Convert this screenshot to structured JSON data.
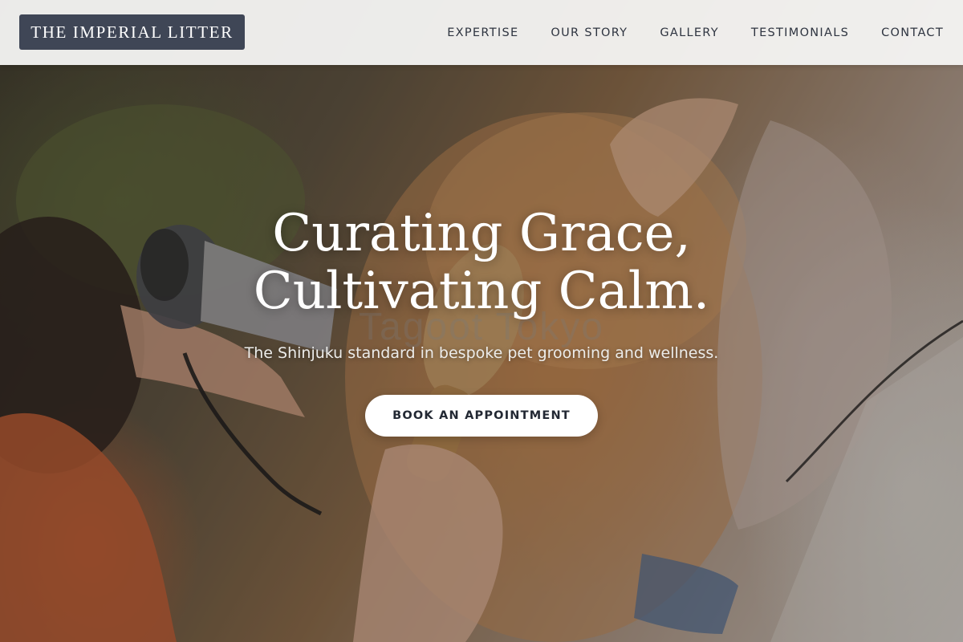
{
  "brand": {
    "logo_text": "THE IMPERIAL LITTER"
  },
  "nav": {
    "items": [
      {
        "label": "EXPERTISE"
      },
      {
        "label": "OUR STORY"
      },
      {
        "label": "GALLERY"
      },
      {
        "label": "TESTIMONIALS"
      },
      {
        "label": "CONTACT"
      }
    ]
  },
  "hero": {
    "headline_line1": "Curating Grace,",
    "headline_line2": "Cultivating Calm.",
    "watermark": "Tagoot Tokyo",
    "subheadline": "The Shinjuku standard in bespoke pet grooming and wellness.",
    "cta_label": "BOOK AN APPOINTMENT",
    "background_photo": "groomer-drying-and-brushing-golden-dog"
  },
  "colors": {
    "logo_bg": "#3f4656",
    "header_bg": "#f6f6f5",
    "nav_text": "#2e3440",
    "cta_bg": "#ffffff",
    "cta_text": "#222833"
  }
}
